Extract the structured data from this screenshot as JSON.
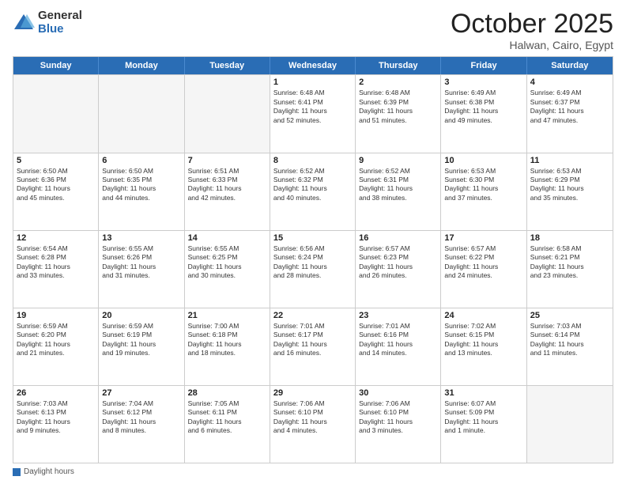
{
  "logo": {
    "general": "General",
    "blue": "Blue"
  },
  "header": {
    "month": "October 2025",
    "location": "Halwan, Cairo, Egypt"
  },
  "weekdays": [
    "Sunday",
    "Monday",
    "Tuesday",
    "Wednesday",
    "Thursday",
    "Friday",
    "Saturday"
  ],
  "rows": [
    [
      {
        "day": "",
        "info": "",
        "empty": true
      },
      {
        "day": "",
        "info": "",
        "empty": true
      },
      {
        "day": "",
        "info": "",
        "empty": true
      },
      {
        "day": "1",
        "info": "Sunrise: 6:48 AM\nSunset: 6:41 PM\nDaylight: 11 hours\nand 52 minutes.",
        "empty": false
      },
      {
        "day": "2",
        "info": "Sunrise: 6:48 AM\nSunset: 6:39 PM\nDaylight: 11 hours\nand 51 minutes.",
        "empty": false
      },
      {
        "day": "3",
        "info": "Sunrise: 6:49 AM\nSunset: 6:38 PM\nDaylight: 11 hours\nand 49 minutes.",
        "empty": false
      },
      {
        "day": "4",
        "info": "Sunrise: 6:49 AM\nSunset: 6:37 PM\nDaylight: 11 hours\nand 47 minutes.",
        "empty": false
      }
    ],
    [
      {
        "day": "5",
        "info": "Sunrise: 6:50 AM\nSunset: 6:36 PM\nDaylight: 11 hours\nand 45 minutes.",
        "empty": false
      },
      {
        "day": "6",
        "info": "Sunrise: 6:50 AM\nSunset: 6:35 PM\nDaylight: 11 hours\nand 44 minutes.",
        "empty": false
      },
      {
        "day": "7",
        "info": "Sunrise: 6:51 AM\nSunset: 6:33 PM\nDaylight: 11 hours\nand 42 minutes.",
        "empty": false
      },
      {
        "day": "8",
        "info": "Sunrise: 6:52 AM\nSunset: 6:32 PM\nDaylight: 11 hours\nand 40 minutes.",
        "empty": false
      },
      {
        "day": "9",
        "info": "Sunrise: 6:52 AM\nSunset: 6:31 PM\nDaylight: 11 hours\nand 38 minutes.",
        "empty": false
      },
      {
        "day": "10",
        "info": "Sunrise: 6:53 AM\nSunset: 6:30 PM\nDaylight: 11 hours\nand 37 minutes.",
        "empty": false
      },
      {
        "day": "11",
        "info": "Sunrise: 6:53 AM\nSunset: 6:29 PM\nDaylight: 11 hours\nand 35 minutes.",
        "empty": false
      }
    ],
    [
      {
        "day": "12",
        "info": "Sunrise: 6:54 AM\nSunset: 6:28 PM\nDaylight: 11 hours\nand 33 minutes.",
        "empty": false
      },
      {
        "day": "13",
        "info": "Sunrise: 6:55 AM\nSunset: 6:26 PM\nDaylight: 11 hours\nand 31 minutes.",
        "empty": false
      },
      {
        "day": "14",
        "info": "Sunrise: 6:55 AM\nSunset: 6:25 PM\nDaylight: 11 hours\nand 30 minutes.",
        "empty": false
      },
      {
        "day": "15",
        "info": "Sunrise: 6:56 AM\nSunset: 6:24 PM\nDaylight: 11 hours\nand 28 minutes.",
        "empty": false
      },
      {
        "day": "16",
        "info": "Sunrise: 6:57 AM\nSunset: 6:23 PM\nDaylight: 11 hours\nand 26 minutes.",
        "empty": false
      },
      {
        "day": "17",
        "info": "Sunrise: 6:57 AM\nSunset: 6:22 PM\nDaylight: 11 hours\nand 24 minutes.",
        "empty": false
      },
      {
        "day": "18",
        "info": "Sunrise: 6:58 AM\nSunset: 6:21 PM\nDaylight: 11 hours\nand 23 minutes.",
        "empty": false
      }
    ],
    [
      {
        "day": "19",
        "info": "Sunrise: 6:59 AM\nSunset: 6:20 PM\nDaylight: 11 hours\nand 21 minutes.",
        "empty": false
      },
      {
        "day": "20",
        "info": "Sunrise: 6:59 AM\nSunset: 6:19 PM\nDaylight: 11 hours\nand 19 minutes.",
        "empty": false
      },
      {
        "day": "21",
        "info": "Sunrise: 7:00 AM\nSunset: 6:18 PM\nDaylight: 11 hours\nand 18 minutes.",
        "empty": false
      },
      {
        "day": "22",
        "info": "Sunrise: 7:01 AM\nSunset: 6:17 PM\nDaylight: 11 hours\nand 16 minutes.",
        "empty": false
      },
      {
        "day": "23",
        "info": "Sunrise: 7:01 AM\nSunset: 6:16 PM\nDaylight: 11 hours\nand 14 minutes.",
        "empty": false
      },
      {
        "day": "24",
        "info": "Sunrise: 7:02 AM\nSunset: 6:15 PM\nDaylight: 11 hours\nand 13 minutes.",
        "empty": false
      },
      {
        "day": "25",
        "info": "Sunrise: 7:03 AM\nSunset: 6:14 PM\nDaylight: 11 hours\nand 11 minutes.",
        "empty": false
      }
    ],
    [
      {
        "day": "26",
        "info": "Sunrise: 7:03 AM\nSunset: 6:13 PM\nDaylight: 11 hours\nand 9 minutes.",
        "empty": false
      },
      {
        "day": "27",
        "info": "Sunrise: 7:04 AM\nSunset: 6:12 PM\nDaylight: 11 hours\nand 8 minutes.",
        "empty": false
      },
      {
        "day": "28",
        "info": "Sunrise: 7:05 AM\nSunset: 6:11 PM\nDaylight: 11 hours\nand 6 minutes.",
        "empty": false
      },
      {
        "day": "29",
        "info": "Sunrise: 7:06 AM\nSunset: 6:10 PM\nDaylight: 11 hours\nand 4 minutes.",
        "empty": false
      },
      {
        "day": "30",
        "info": "Sunrise: 7:06 AM\nSunset: 6:10 PM\nDaylight: 11 hours\nand 3 minutes.",
        "empty": false
      },
      {
        "day": "31",
        "info": "Sunrise: 6:07 AM\nSunset: 5:09 PM\nDaylight: 11 hours\nand 1 minute.",
        "empty": false
      },
      {
        "day": "",
        "info": "",
        "empty": true
      }
    ]
  ],
  "footer": {
    "label": "Daylight hours"
  }
}
